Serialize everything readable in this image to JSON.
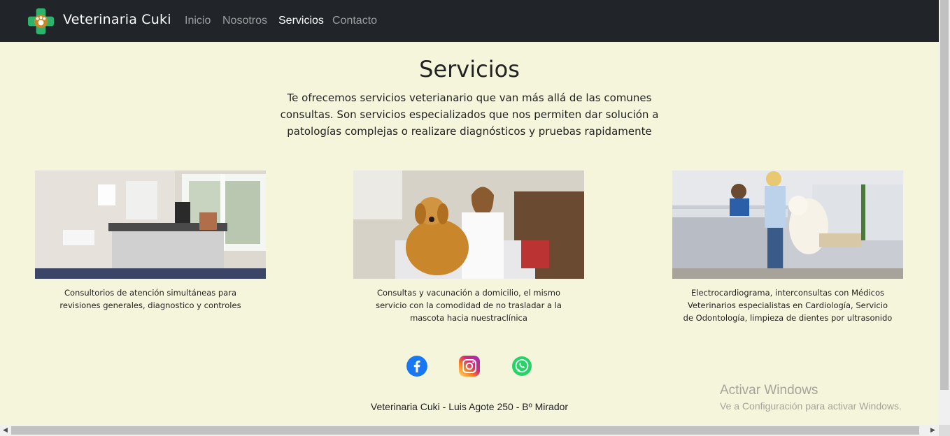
{
  "navbar": {
    "brand": "Veterinaria Cuki",
    "links": [
      {
        "label": "Inicio",
        "active": false
      },
      {
        "label": "Nosotros",
        "active": false
      },
      {
        "label": "Servicios",
        "active": true
      },
      {
        "label": "Contacto",
        "active": false
      }
    ]
  },
  "main": {
    "title": "Servicios",
    "intro": "Te ofrecemos servicios veterianario que van más allá de las comunes consultas. Son servicios especializados que nos permiten dar solución a patologías complejas o realizare diagnósticos y pruebas rapidamente",
    "cards": [
      {
        "text": "Consultorios de atención simultáneas para revisiones generales, diagnostico y controles"
      },
      {
        "text": "Consultas y vacunación a domicilio, el mismo servicio con la comodidad de no trasladar a la mascota hacia nuestraclínica"
      },
      {
        "text": "Electrocardiograma, interconsultas con Médicos Veterinarios especialistas en Cardiología, Servicio de Odontología, limpieza de dientes por ultrasonido"
      }
    ]
  },
  "social": [
    "facebook-icon",
    "instagram-icon",
    "whatsapp-icon"
  ],
  "footer": {
    "text": "Veterinaria Cuki - Luis Agote 250 - Bº Mirador"
  },
  "watermark": {
    "title": "Activar Windows",
    "subtitle": "Ve a Configuración para activar Windows."
  },
  "colors": {
    "navbar": "#212529",
    "background": "#f5f5dc",
    "facebook": "#1877f2",
    "whatsapp": "#25d366"
  }
}
